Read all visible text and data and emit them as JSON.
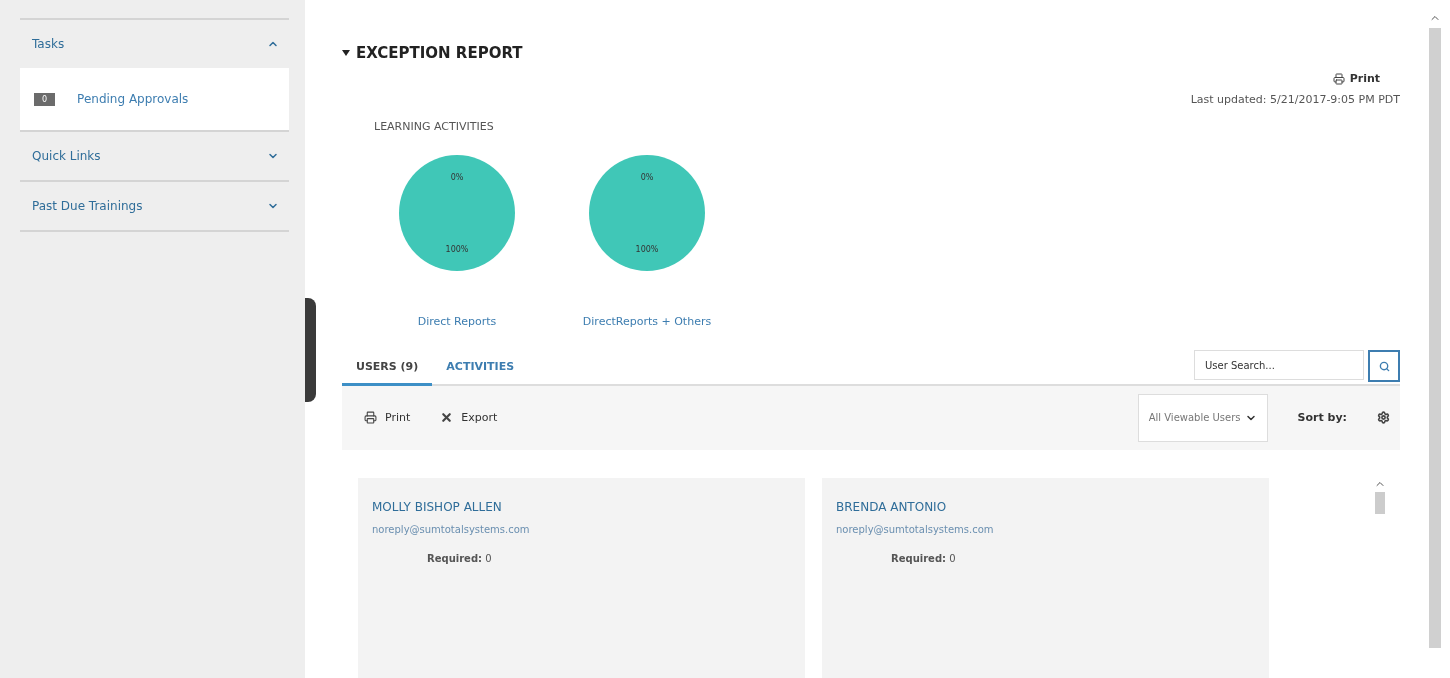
{
  "sidebar": {
    "sections": [
      {
        "title": "Tasks",
        "expanded": true,
        "items": [
          {
            "count": "0",
            "label": "Pending Approvals"
          }
        ]
      },
      {
        "title": "Quick Links",
        "expanded": false
      },
      {
        "title": "Past Due Trainings",
        "expanded": false
      }
    ]
  },
  "report": {
    "title": "EXCEPTION REPORT",
    "expanded": true,
    "print": "Print",
    "last_updated": "Last updated: 5/21/2017-9:05 PM PDT",
    "section_label": "LEARNING ACTIVITIES",
    "charts": [
      {
        "link": "Direct Reports",
        "chart_data": {
          "type": "pie",
          "values": [
            0,
            100
          ],
          "color": "#40c7b7",
          "value_labels": [
            "0%",
            "100%"
          ]
        }
      },
      {
        "link": "DirectReports + Others",
        "chart_data": {
          "type": "pie",
          "values": [
            0,
            100
          ],
          "color": "#40c7b7",
          "value_labels": [
            "0%",
            "100%"
          ]
        }
      }
    ]
  },
  "tabs": [
    {
      "label": "USERS (9)",
      "selected": true
    },
    {
      "label": "ACTIVITIES",
      "selected": false
    }
  ],
  "search": {
    "placeholder": "User Search..."
  },
  "toolbar": {
    "print": "Print",
    "export": "Export",
    "filter": "All Viewable Users",
    "sort_label": "Sort by:"
  },
  "users": [
    {
      "name": "MOLLY BISHOP ALLEN",
      "email": "noreply@sumtotalsystems.com",
      "required_label": "Required:",
      "required": "0"
    },
    {
      "name": "BRENDA ANTONIO",
      "email": "noreply@sumtotalsystems.com",
      "required_label": "Required:",
      "required": "0"
    }
  ]
}
